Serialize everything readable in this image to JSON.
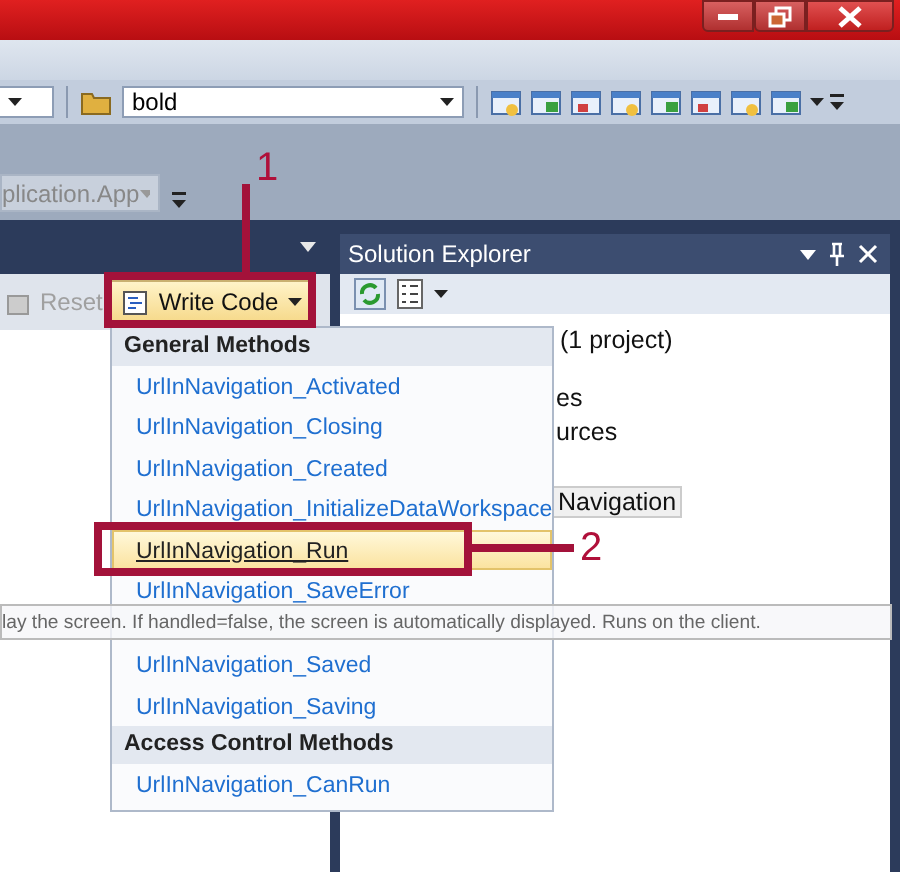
{
  "style_combo": {
    "value": "bold"
  },
  "document_tab": {
    "label": "plication.App"
  },
  "reset_button": {
    "label": "Reset",
    "disabled": true
  },
  "write_code_button": {
    "label": "Write Code",
    "expanded": true
  },
  "solution_explorer": {
    "title": "Solution Explorer",
    "nodes": [
      {
        "label": "(1 project)",
        "selected": false
      },
      {
        "label": "es",
        "selected": false
      },
      {
        "label": "urces",
        "selected": false
      },
      {
        "label": "Navigation",
        "selected": true
      }
    ]
  },
  "write_code_menu": {
    "sections": [
      {
        "header": "General Methods",
        "items": [
          {
            "label": "UrlInNavigation_Activated",
            "selected": false
          },
          {
            "label": "UrlInNavigation_Closing",
            "selected": false
          },
          {
            "label": "UrlInNavigation_Created",
            "selected": false
          },
          {
            "label": "UrlInNavigation_InitializeDataWorkspace",
            "selected": false
          },
          {
            "label": "UrlInNavigation_Run",
            "selected": true
          },
          {
            "label": "UrlInNavigation_SaveError",
            "selected": false
          },
          {
            "label": "UrlInNavigation_Saved",
            "selected": false
          },
          {
            "label": "UrlInNavigation_Saving",
            "selected": false
          }
        ]
      },
      {
        "header": "Access Control Methods",
        "items": [
          {
            "label": "UrlInNavigation_CanRun",
            "selected": false
          }
        ]
      }
    ]
  },
  "tooltip": {
    "text": "lay the screen.  If handled=false, the screen is automatically displayed.  Runs on the client."
  },
  "callouts": [
    {
      "number": "1"
    },
    {
      "number": "2"
    }
  ]
}
